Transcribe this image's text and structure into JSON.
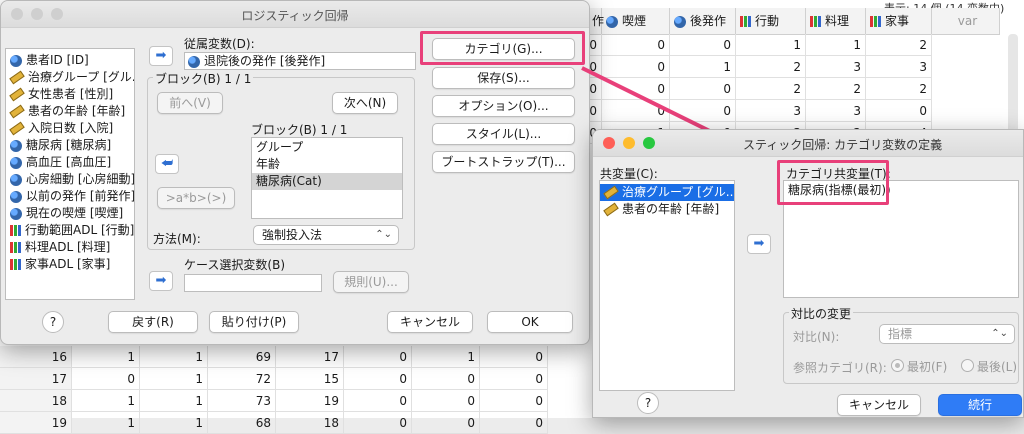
{
  "sheet": {
    "status": "表示: 14 個 (14 変数中)",
    "col_partial": "作",
    "columns": [
      "喫煙",
      "後発作",
      "行動",
      "料理",
      "家事",
      "var"
    ],
    "top_rows": [
      [
        "0",
        "0",
        "0",
        "1",
        "1",
        "2"
      ],
      [
        "0",
        "0",
        "1",
        "2",
        "3",
        "3"
      ],
      [
        "0",
        "0",
        "0",
        "2",
        "2",
        "2"
      ],
      [
        "0",
        "0",
        "0",
        "3",
        "3",
        "0"
      ],
      [
        "0",
        "1",
        "0",
        "3",
        "2",
        "4"
      ]
    ],
    "bottom_rows": [
      {
        "n": "16",
        "cells": [
          "1",
          "1",
          "69",
          "17",
          "0",
          "1",
          "0"
        ]
      },
      {
        "n": "17",
        "cells": [
          "0",
          "1",
          "72",
          "15",
          "0",
          "0",
          "0"
        ]
      },
      {
        "n": "18",
        "cells": [
          "1",
          "1",
          "73",
          "19",
          "0",
          "0",
          "0"
        ]
      },
      {
        "n": "19",
        "cells": [
          "1",
          "1",
          "68",
          "18",
          "0",
          "0",
          "0"
        ]
      }
    ]
  },
  "main_dialog": {
    "title": "ロジスティック回帰",
    "variables": [
      {
        "label": "患者ID [ID]",
        "icon": "ball-icon"
      },
      {
        "label": "治療グループ [グル...",
        "icon": "ruler-icon"
      },
      {
        "label": "女性患者 [性別]",
        "icon": "ruler-icon"
      },
      {
        "label": "患者の年齢 [年齢]",
        "icon": "ruler-icon"
      },
      {
        "label": "入院日数 [入院]",
        "icon": "ruler-icon"
      },
      {
        "label": "糖尿病 [糖尿病]",
        "icon": "ball-icon"
      },
      {
        "label": "高血圧 [高血圧]",
        "icon": "ball-icon"
      },
      {
        "label": "心房細動 [心房細動]",
        "icon": "ball-icon"
      },
      {
        "label": "以前の発作 [前発作]",
        "icon": "ball-icon"
      },
      {
        "label": "現在の喫煙 [喫煙]",
        "icon": "ball-icon"
      },
      {
        "label": "行動範囲ADL [行動]",
        "icon": "bar-icon"
      },
      {
        "label": "料理ADL [料理]",
        "icon": "bar-icon"
      },
      {
        "label": "家事ADL [家事]",
        "icon": "bar-icon"
      }
    ],
    "dependent_label": "従属変数(D):",
    "dependent_value": "退院後の発作 [後発作]",
    "block_label": "ブロック(B) 1 / 1",
    "prev_button": "前へ(V)",
    "next_button": "次へ(N)",
    "block_list_label": "ブロック(B) 1 / 1",
    "block_items": [
      "グループ",
      "年齢",
      "糖尿病(Cat)"
    ],
    "interaction_button": ">a*b>(>)",
    "method_label": "方法(M):",
    "method_value": "強制投入法",
    "case_select_label": "ケース選択変数(B)",
    "rule_button": "規則(U)...",
    "side_buttons": [
      "カテゴリ(G)...",
      "保存(S)...",
      "オプション(O)...",
      "スタイル(L)...",
      "ブートストラップ(T)..."
    ],
    "help_button": "?",
    "back_button": "戻す(R)",
    "paste_button": "貼り付け(P)",
    "cancel_button": "キャンセル",
    "ok_button": "OK"
  },
  "cat_dialog": {
    "title": "スティック回帰: カテゴリ変数の定義",
    "covariates_label": "共変量(C):",
    "covariates": [
      {
        "label": "治療グループ [グル...",
        "icon": "ruler-icon"
      },
      {
        "label": "患者の年齢 [年齢]",
        "icon": "ruler-icon"
      }
    ],
    "cat_covariates_label": "カテゴリ共変量(T):",
    "cat_covariates": [
      "糖尿病(指標(最初))"
    ],
    "contrast_group": "対比の変更",
    "contrast_label": "対比(N):",
    "contrast_value": "指標",
    "ref_label": "参照カテゴリ(R):",
    "ref_first": "最初(F)",
    "ref_last": "最後(L)",
    "help_button": "?",
    "cancel_button": "キャンセル",
    "continue_button": "続行"
  },
  "colors": {
    "highlight": "#e8407a",
    "primary": "#2f7cf6",
    "selection": "#1a6ee6"
  }
}
